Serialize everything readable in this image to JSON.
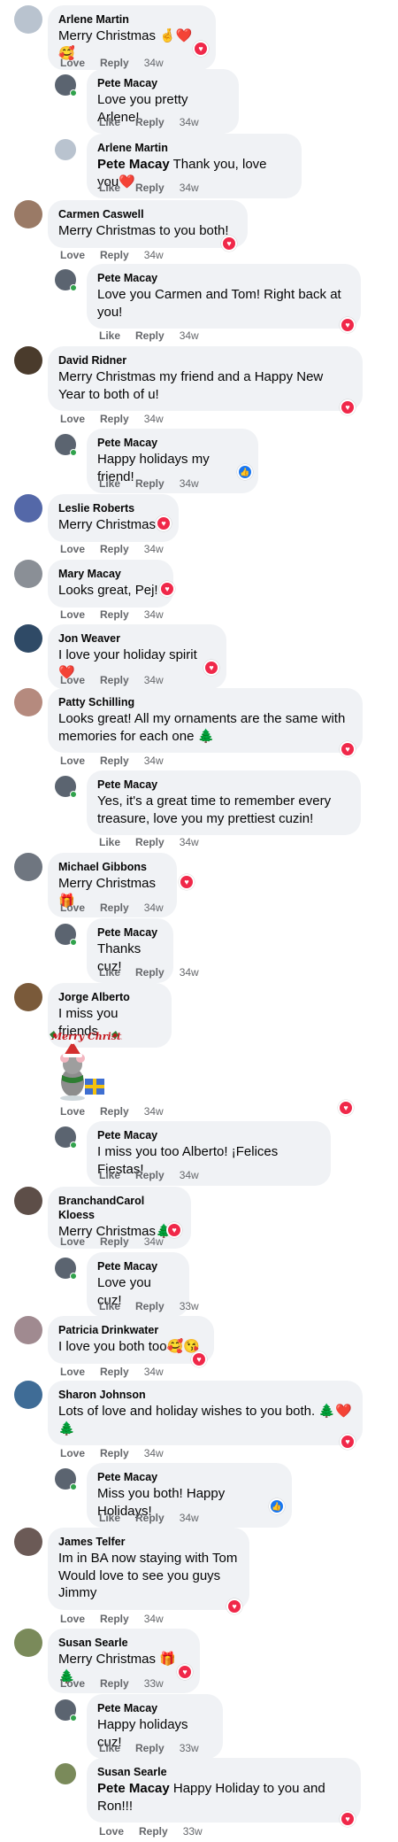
{
  "labels": {
    "love": "Love",
    "like": "Like",
    "reply": "Reply"
  },
  "reaction_icons": {
    "love": "heart-reaction-icon",
    "like": "thumbs-up-reaction-icon"
  },
  "comments": [
    {
      "name": "Arlene Martin",
      "text": "Merry Christmas",
      "emoji": "🤞❤️🥰",
      "action": "Love",
      "time": "34w",
      "avatar_color": "#b9c3cf"
    },
    {
      "name": "Pete Macay",
      "text": "Love you pretty Arlene!",
      "action": "Like",
      "time": "34w",
      "avatar_color": "#5b6470"
    },
    {
      "name": "Arlene Martin",
      "tag": "Pete Macay",
      "text": " Thank you, love you",
      "emoji": "❤️",
      "action": "Like",
      "time": "34w",
      "avatar_color": "#b9c3cf"
    },
    {
      "name": "Carmen Caswell",
      "text": "Merry Christmas to you both!",
      "action": "Love",
      "time": "34w",
      "avatar_color": "#9a7a66"
    },
    {
      "name": "Pete Macay",
      "text": "Love you Carmen and Tom! Right back at you!",
      "action": "Like",
      "time": "34w",
      "avatar_color": "#5b6470"
    },
    {
      "name": "David Ridner",
      "text": "Merry Christmas my friend and a Happy New Year to both of u!",
      "action": "Love",
      "time": "34w",
      "avatar_color": "#4a3b2c"
    },
    {
      "name": "Pete Macay",
      "text": "Happy holidays my friend!",
      "action": "Like",
      "time": "34w",
      "avatar_color": "#5b6470"
    },
    {
      "name": "Leslie Roberts",
      "text": "Merry Christmas",
      "action": "Love",
      "time": "34w",
      "avatar_color": "#5468a8"
    },
    {
      "name": "Mary Macay",
      "text": "Looks great, Pej!",
      "action": "Love",
      "time": "34w",
      "avatar_color": "#8a8f96"
    },
    {
      "name": "Jon Weaver",
      "text": "I love your holiday spirit",
      "emoji": "❤️",
      "action": "Love",
      "time": "34w",
      "avatar_color": "#2f4a66"
    },
    {
      "name": "Patty Schilling",
      "text": "Looks great! All my ornaments are the same with memories for each one",
      "emoji": "🌲",
      "action": "Love",
      "time": "34w",
      "avatar_color": "#b58a7e"
    },
    {
      "name": "Pete Macay",
      "text": "Yes, it's a great time to remember every treasure, love you my prettiest cuzin!",
      "action": "Like",
      "time": "34w",
      "avatar_color": "#5b6470"
    },
    {
      "name": "Michael Gibbons",
      "text": "Merry Christmas",
      "emoji": "🎁",
      "action": "Love",
      "time": "34w",
      "avatar_color": "#6f7680"
    },
    {
      "name": "Pete Macay",
      "text": "Thanks cuz!",
      "action": "Like",
      "time": "34w",
      "avatar_color": "#5b6470"
    },
    {
      "name": "Jorge Alberto",
      "text": "I miss you friends",
      "sticker_text": "Merry Christmas",
      "action": "Love",
      "time": "34w",
      "avatar_color": "#7a5a3a"
    },
    {
      "name": "Pete Macay",
      "text": "I miss you too Alberto! ¡Felices Fiestas!",
      "action": "Like",
      "time": "34w",
      "avatar_color": "#5b6470"
    },
    {
      "name": "BranchandCarol Kloess",
      "text": "Merry Christmas",
      "emoji": "🌲",
      "action": "Love",
      "time": "34w",
      "avatar_color": "#5d4e48"
    },
    {
      "name": "Pete Macay",
      "text": "Love you cuz!",
      "action": "Like",
      "time": "33w",
      "avatar_color": "#5b6470"
    },
    {
      "name": "Patricia Drinkwater",
      "text": "I love you both too",
      "emoji": "🥰😘",
      "action": "Love",
      "time": "34w",
      "avatar_color": "#a08a90"
    },
    {
      "name": "Sharon Johnson",
      "text": "Lots of love and holiday wishes to you both. 🌲❤️ 🌲",
      "action": "Love",
      "time": "34w",
      "avatar_color": "#3f6c96"
    },
    {
      "name": "Pete Macay",
      "text": "Miss you both! Happy Holidays!",
      "action": "Like",
      "time": "34w",
      "avatar_color": "#5b6470"
    },
    {
      "name": "James Telfer",
      "text": "Im in BA now staying with Tom Would love to see you guys Jimmy",
      "action": "Love",
      "time": "34w",
      "avatar_color": "#6b5a56"
    },
    {
      "name": "Susan Searle",
      "text": "Merry Christmas",
      "emoji": "🎁🌲",
      "action": "Love",
      "time": "33w",
      "avatar_color": "#7a8a5a"
    },
    {
      "name": "Pete Macay",
      "text": "Happy holidays cuz!",
      "action": "Like",
      "time": "33w",
      "avatar_color": "#5b6470"
    },
    {
      "name": "Susan Searle",
      "tag": "Pete Macay",
      "text": " Happy Holiday to you and Ron!!!",
      "action": "Love",
      "time": "33w",
      "avatar_color": "#7a8a5a"
    }
  ]
}
